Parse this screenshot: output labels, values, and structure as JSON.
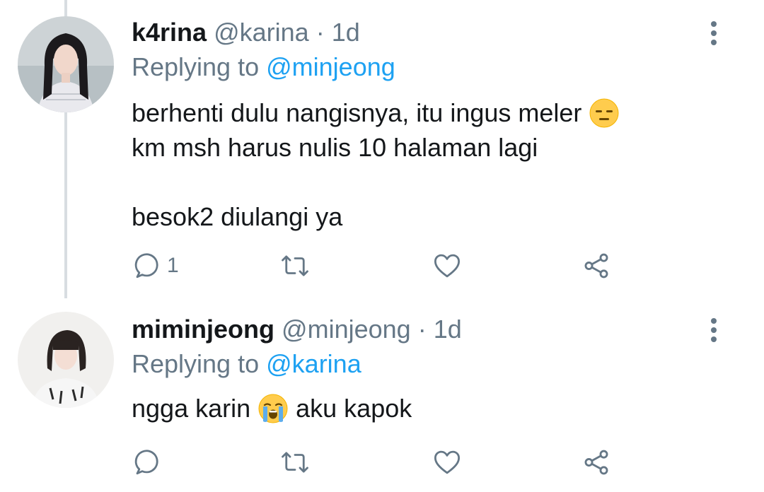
{
  "colors": {
    "name": "#14171a",
    "secondary": "#657786",
    "mention": "#1da1f2",
    "thread_line": "#d8dde1",
    "icon": "#657786"
  },
  "tweets": [
    {
      "display_name": "k4rina",
      "handle": "@karina",
      "separator": "·",
      "time": "1d",
      "reply_prefix": "Replying to",
      "reply_mention": "@minjeong",
      "lines": [
        "berhenti dulu nangisnya, itu ingus meler",
        "km msh harus nulis 10 halaman lagi",
        "",
        "besok2 diulangi ya"
      ],
      "emoji": "expressionless-face",
      "reply_count": "1",
      "icons": [
        "reply-icon",
        "retweet-icon",
        "like-icon",
        "share-icon",
        "more-options-icon"
      ]
    },
    {
      "display_name": "miminjeong",
      "handle": "@minjeong",
      "separator": "·",
      "time": "1d",
      "reply_prefix": "Replying to",
      "reply_mention": "@karina",
      "text_before": "ngga karin",
      "text_after": "aku kapok",
      "emoji": "loudly-crying-face",
      "reply_count": "",
      "icons": [
        "reply-icon",
        "retweet-icon",
        "like-icon",
        "share-icon",
        "more-options-icon"
      ]
    }
  ]
}
